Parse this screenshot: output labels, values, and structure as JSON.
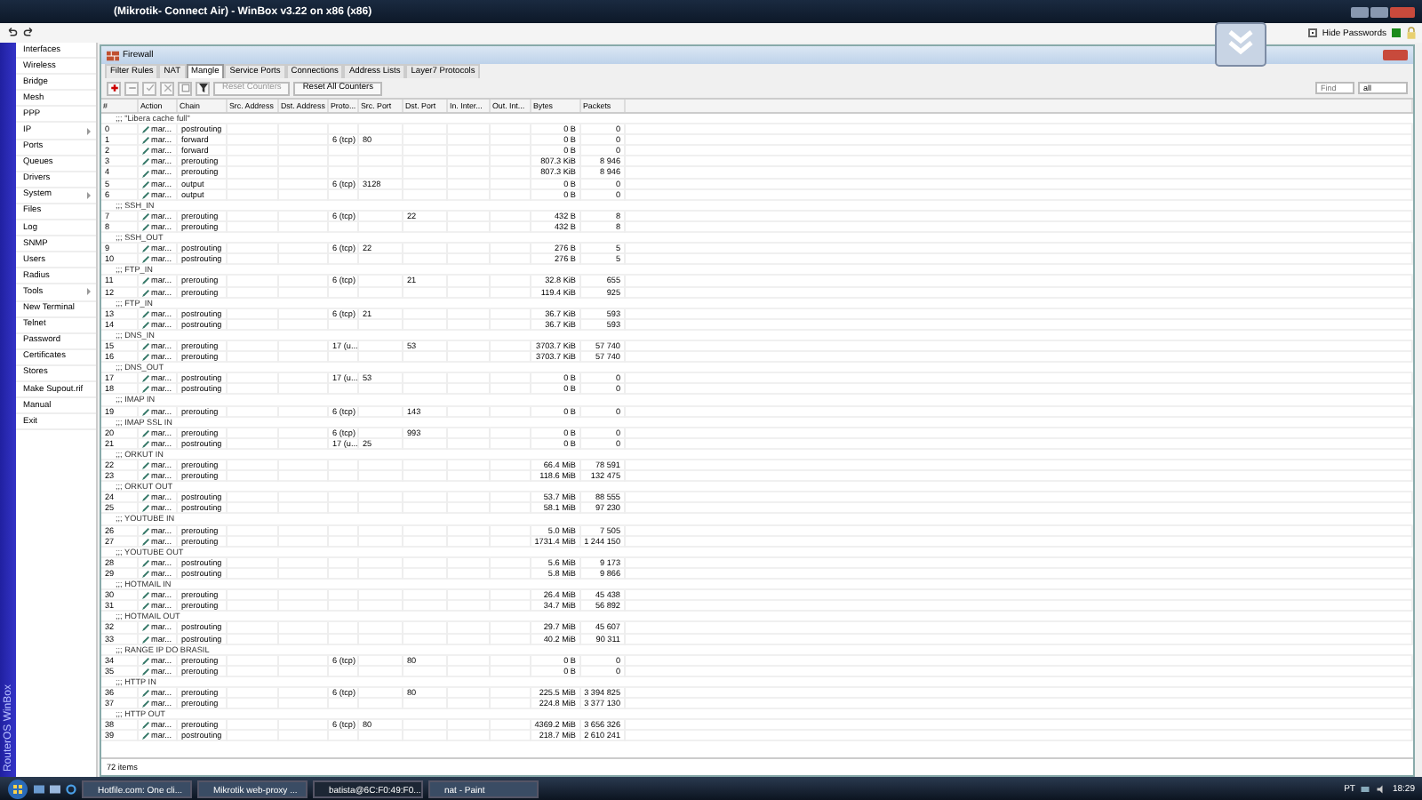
{
  "window": {
    "title": "(Mikrotik- Connect Air) - WinBox v3.22 on x86 (x86)"
  },
  "hide_passwords": {
    "label": "Hide Passwords",
    "checked": true
  },
  "sidebar": {
    "brand": "RouterOS WinBox",
    "items": [
      {
        "label": "Interfaces",
        "submenu": false
      },
      {
        "label": "Wireless",
        "submenu": false
      },
      {
        "label": "Bridge",
        "submenu": false
      },
      {
        "label": "Mesh",
        "submenu": false
      },
      {
        "label": "PPP",
        "submenu": false
      },
      {
        "label": "IP",
        "submenu": true
      },
      {
        "label": "Ports",
        "submenu": false
      },
      {
        "label": "Queues",
        "submenu": false
      },
      {
        "label": "Drivers",
        "submenu": false
      },
      {
        "label": "System",
        "submenu": true
      },
      {
        "label": "Files",
        "submenu": false
      },
      {
        "label": "Log",
        "submenu": false
      },
      {
        "label": "SNMP",
        "submenu": false
      },
      {
        "label": "Users",
        "submenu": false
      },
      {
        "label": "Radius",
        "submenu": false
      },
      {
        "label": "Tools",
        "submenu": true
      },
      {
        "label": "New Terminal",
        "submenu": false
      },
      {
        "label": "Telnet",
        "submenu": false
      },
      {
        "label": "Password",
        "submenu": false
      },
      {
        "label": "Certificates",
        "submenu": false
      },
      {
        "label": "Stores",
        "submenu": false
      },
      {
        "label": "Make Supout.rif",
        "submenu": false
      },
      {
        "label": "Manual",
        "submenu": false
      },
      {
        "label": "Exit",
        "submenu": false
      }
    ]
  },
  "firewall": {
    "title": "Firewall",
    "tabs": [
      {
        "label": "Filter Rules",
        "selected": false
      },
      {
        "label": "NAT",
        "selected": false
      },
      {
        "label": "Mangle",
        "selected": true
      },
      {
        "label": "Service Ports",
        "selected": false
      },
      {
        "label": "Connections",
        "selected": false
      },
      {
        "label": "Address Lists",
        "selected": false
      },
      {
        "label": "Layer7 Protocols",
        "selected": false
      }
    ],
    "toolbar": {
      "reset_counters": {
        "label": "Reset Counters",
        "disabled": true
      },
      "reset_all_counters": {
        "label": "Reset All Counters",
        "disabled": false
      },
      "find": {
        "placeholder": "Find"
      },
      "filter_value": "all"
    },
    "columns": [
      "#",
      "Action",
      "Chain",
      "Src. Address",
      "Dst. Address",
      "Proto...",
      "Src. Port",
      "Dst. Port",
      "In. Inter...",
      "Out. Int...",
      "Bytes",
      "Packets"
    ],
    "rows": [
      {
        "kind": "comment",
        "text": ";;; \"Libera cache full\""
      },
      {
        "kind": "rule",
        "n": "0",
        "action": "mar...",
        "chain": "postrouting",
        "bytes": "0 B",
        "packets": "0"
      },
      {
        "kind": "rule",
        "n": "1",
        "action": "mar...",
        "chain": "forward",
        "proto": "6 (tcp)",
        "src_port": "80",
        "bytes": "0 B",
        "packets": "0"
      },
      {
        "kind": "rule",
        "n": "2",
        "action": "mar...",
        "chain": "forward",
        "bytes": "0 B",
        "packets": "0"
      },
      {
        "kind": "rule",
        "n": "3",
        "action": "mar...",
        "chain": "prerouting",
        "bytes": "807.3 KiB",
        "packets": "8 946"
      },
      {
        "kind": "rule",
        "n": "4",
        "action": "mar...",
        "chain": "prerouting",
        "bytes": "807.3 KiB",
        "packets": "8 946"
      },
      {
        "kind": "rule",
        "n": "5",
        "action": "mar...",
        "chain": "output",
        "proto": "6 (tcp)",
        "src_port": "3128",
        "bytes": "0 B",
        "packets": "0"
      },
      {
        "kind": "rule",
        "n": "6",
        "action": "mar...",
        "chain": "output",
        "bytes": "0 B",
        "packets": "0"
      },
      {
        "kind": "comment",
        "text": ";;; SSH_IN"
      },
      {
        "kind": "rule",
        "n": "7",
        "action": "mar...",
        "chain": "prerouting",
        "proto": "6 (tcp)",
        "dst_port": "22",
        "bytes": "432 B",
        "packets": "8"
      },
      {
        "kind": "rule",
        "n": "8",
        "action": "mar...",
        "chain": "prerouting",
        "bytes": "432 B",
        "packets": "8"
      },
      {
        "kind": "comment",
        "text": ";;; SSH_OUT"
      },
      {
        "kind": "rule",
        "n": "9",
        "action": "mar...",
        "chain": "postrouting",
        "proto": "6 (tcp)",
        "src_port": "22",
        "bytes": "276 B",
        "packets": "5"
      },
      {
        "kind": "rule",
        "n": "10",
        "action": "mar...",
        "chain": "postrouting",
        "bytes": "276 B",
        "packets": "5"
      },
      {
        "kind": "comment",
        "text": ";;; FTP_IN"
      },
      {
        "kind": "rule",
        "n": "11",
        "action": "mar...",
        "chain": "prerouting",
        "proto": "6 (tcp)",
        "dst_port": "21",
        "bytes": "32.8 KiB",
        "packets": "655"
      },
      {
        "kind": "rule",
        "n": "12",
        "action": "mar...",
        "chain": "prerouting",
        "bytes": "119.4 KiB",
        "packets": "925"
      },
      {
        "kind": "comment",
        "text": ";;; FTP_IN"
      },
      {
        "kind": "rule",
        "n": "13",
        "action": "mar...",
        "chain": "postrouting",
        "proto": "6 (tcp)",
        "src_port": "21",
        "bytes": "36.7 KiB",
        "packets": "593"
      },
      {
        "kind": "rule",
        "n": "14",
        "action": "mar...",
        "chain": "postrouting",
        "bytes": "36.7 KiB",
        "packets": "593"
      },
      {
        "kind": "comment",
        "text": ";;; DNS_IN"
      },
      {
        "kind": "rule",
        "n": "15",
        "action": "mar...",
        "chain": "prerouting",
        "proto": "17 (u...",
        "dst_port": "53",
        "bytes": "3703.7 KiB",
        "packets": "57 740"
      },
      {
        "kind": "rule",
        "n": "16",
        "action": "mar...",
        "chain": "prerouting",
        "bytes": "3703.7 KiB",
        "packets": "57 740"
      },
      {
        "kind": "comment",
        "text": ";;; DNS_OUT"
      },
      {
        "kind": "rule",
        "n": "17",
        "action": "mar...",
        "chain": "postrouting",
        "proto": "17 (u...",
        "src_port": "53",
        "bytes": "0 B",
        "packets": "0"
      },
      {
        "kind": "rule",
        "n": "18",
        "action": "mar...",
        "chain": "postrouting",
        "bytes": "0 B",
        "packets": "0"
      },
      {
        "kind": "comment",
        "text": ";;; IMAP IN"
      },
      {
        "kind": "rule",
        "n": "19",
        "action": "mar...",
        "chain": "prerouting",
        "proto": "6 (tcp)",
        "dst_port": "143",
        "bytes": "0 B",
        "packets": "0"
      },
      {
        "kind": "comment",
        "text": ";;; IMAP SSL IN"
      },
      {
        "kind": "rule",
        "n": "20",
        "action": "mar...",
        "chain": "prerouting",
        "proto": "6 (tcp)",
        "dst_port": "993",
        "bytes": "0 B",
        "packets": "0"
      },
      {
        "kind": "rule",
        "n": "21",
        "action": "mar...",
        "chain": "postrouting",
        "proto": "17 (u...",
        "src_port": "25",
        "bytes": "0 B",
        "packets": "0"
      },
      {
        "kind": "comment",
        "text": ";;; ORKUT IN"
      },
      {
        "kind": "rule",
        "n": "22",
        "action": "mar...",
        "chain": "prerouting",
        "bytes": "66.4 MiB",
        "packets": "78 591"
      },
      {
        "kind": "rule",
        "n": "23",
        "action": "mar...",
        "chain": "prerouting",
        "bytes": "118.6 MiB",
        "packets": "132 475"
      },
      {
        "kind": "comment",
        "text": ";;; ORKUT OUT"
      },
      {
        "kind": "rule",
        "n": "24",
        "action": "mar...",
        "chain": "postrouting",
        "bytes": "53.7 MiB",
        "packets": "88 555"
      },
      {
        "kind": "rule",
        "n": "25",
        "action": "mar...",
        "chain": "postrouting",
        "bytes": "58.1 MiB",
        "packets": "97 230"
      },
      {
        "kind": "comment",
        "text": ";;; YOUTUBE IN"
      },
      {
        "kind": "rule",
        "n": "26",
        "action": "mar...",
        "chain": "prerouting",
        "bytes": "5.0 MiB",
        "packets": "7 505"
      },
      {
        "kind": "rule",
        "n": "27",
        "action": "mar...",
        "chain": "prerouting",
        "bytes": "1731.4 MiB",
        "packets": "1 244 150"
      },
      {
        "kind": "comment",
        "text": ";;; YOUTUBE OUT"
      },
      {
        "kind": "rule",
        "n": "28",
        "action": "mar...",
        "chain": "postrouting",
        "bytes": "5.6 MiB",
        "packets": "9 173"
      },
      {
        "kind": "rule",
        "n": "29",
        "action": "mar...",
        "chain": "postrouting",
        "bytes": "5.8 MiB",
        "packets": "9 866"
      },
      {
        "kind": "comment",
        "text": ";;; HOTMAIL IN"
      },
      {
        "kind": "rule",
        "n": "30",
        "action": "mar...",
        "chain": "prerouting",
        "bytes": "26.4 MiB",
        "packets": "45 438"
      },
      {
        "kind": "rule",
        "n": "31",
        "action": "mar...",
        "chain": "prerouting",
        "bytes": "34.7 MiB",
        "packets": "56 892"
      },
      {
        "kind": "comment",
        "text": ";;; HOTMAIL OUT"
      },
      {
        "kind": "rule",
        "n": "32",
        "action": "mar...",
        "chain": "postrouting",
        "bytes": "29.7 MiB",
        "packets": "45 607"
      },
      {
        "kind": "rule",
        "n": "33",
        "action": "mar...",
        "chain": "postrouting",
        "bytes": "40.2 MiB",
        "packets": "90 311"
      },
      {
        "kind": "comment",
        "text": ";;; RANGE IP DO BRASIL"
      },
      {
        "kind": "rule",
        "n": "34",
        "action": "mar...",
        "chain": "prerouting",
        "proto": "6 (tcp)",
        "dst_port": "80",
        "bytes": "0 B",
        "packets": "0"
      },
      {
        "kind": "rule",
        "n": "35",
        "action": "mar...",
        "chain": "prerouting",
        "bytes": "0 B",
        "packets": "0"
      },
      {
        "kind": "comment",
        "text": ";;; HTTP IN"
      },
      {
        "kind": "rule",
        "n": "36",
        "action": "mar...",
        "chain": "prerouting",
        "proto": "6 (tcp)",
        "dst_port": "80",
        "bytes": "225.5 MiB",
        "packets": "3 394 825"
      },
      {
        "kind": "rule",
        "n": "37",
        "action": "mar...",
        "chain": "prerouting",
        "bytes": "224.8 MiB",
        "packets": "3 377 130"
      },
      {
        "kind": "comment",
        "text": ";;; HTTP OUT"
      },
      {
        "kind": "rule",
        "n": "38",
        "action": "mar...",
        "chain": "prerouting",
        "proto": "6 (tcp)",
        "src_port": "80",
        "bytes": "4369.2 MiB",
        "packets": "3 656 326"
      },
      {
        "kind": "rule",
        "n": "39",
        "action": "mar...",
        "chain": "postrouting",
        "bytes": "218.7 MiB",
        "packets": "2 610 241"
      }
    ],
    "status": "72 items"
  },
  "taskbar": {
    "tasks": [
      {
        "label": "Hotfile.com: One cli...",
        "selected": false
      },
      {
        "label": "Mikrotik web-proxy ...",
        "selected": false
      },
      {
        "label": "batista@6C:F0:49:F0...",
        "selected": true
      },
      {
        "label": "nat - Paint",
        "selected": false
      }
    ],
    "language": "PT",
    "clock": "18:29"
  }
}
